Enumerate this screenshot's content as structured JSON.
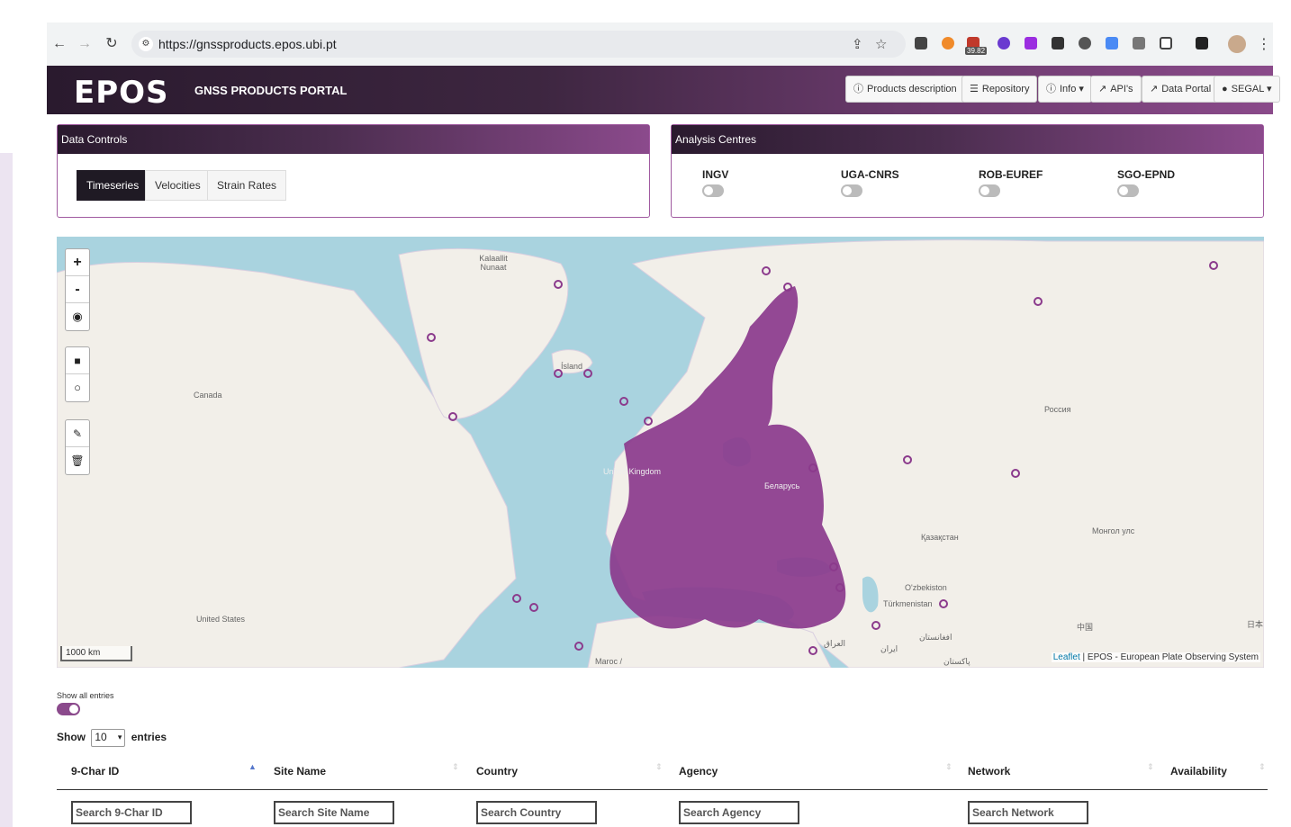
{
  "browser": {
    "url": "https://gnssproducts.epos.ubi.pt",
    "ext_badge": "39.82"
  },
  "header": {
    "logo": "EPOS",
    "title": "GNSS PRODUCTS PORTAL",
    "buttons": {
      "products": "Products description",
      "repository": "Repository",
      "info": "Info ▾",
      "apis": "API's",
      "portal": "Data Portal",
      "user": "SEGAL ▾"
    }
  },
  "data_controls": {
    "title": "Data Controls",
    "tabs": [
      "Timeseries",
      "Velocities",
      "Strain Rates"
    ],
    "active_tab": "Timeseries"
  },
  "analysis_centres": {
    "title": "Analysis Centres",
    "items": [
      "INGV",
      "UGA-CNRS",
      "ROB-EUREF",
      "SGO-EPND"
    ]
  },
  "map": {
    "zoom_in": "+",
    "zoom_out": "-",
    "labels": {
      "kalaallit": "Kalaallit Nunaat",
      "canada": "Canada",
      "usa": "United States",
      "island": "Ísland",
      "russia": "Россия",
      "kazakhstan": "Қазақстан",
      "mongolia": "Монгол улс",
      "uzbekistan": "O'zbekiston",
      "turkmenistan": "Türkmenistan",
      "china": "中国",
      "japan": "日本",
      "iran": "ایران",
      "afghanistan": "افغانستان",
      "pakistan": "پاکستان",
      "iraq": "العراق",
      "morocco": "Maroc /",
      "uk": "United Kingdom",
      "belarus": "Беларусь"
    },
    "scale": "1000 km",
    "attribution_leaflet": "Leaflet",
    "attribution_rest": " | EPOS - European Plate Observing System",
    "marker_color": "#8b3a8c",
    "water_color": "#a9d3df"
  },
  "table": {
    "show_all_label": "Show all entries",
    "show_label": "Show",
    "length": "10",
    "entries_label": "entries",
    "columns": [
      "9-Char ID",
      "Site Name",
      "Country",
      "Agency",
      "Network",
      "Availability"
    ],
    "search": {
      "id": "Search 9-Char ID",
      "site": "Search Site Name",
      "country": "Search Country",
      "agency": "Search Agency",
      "network": "Search Network"
    }
  }
}
